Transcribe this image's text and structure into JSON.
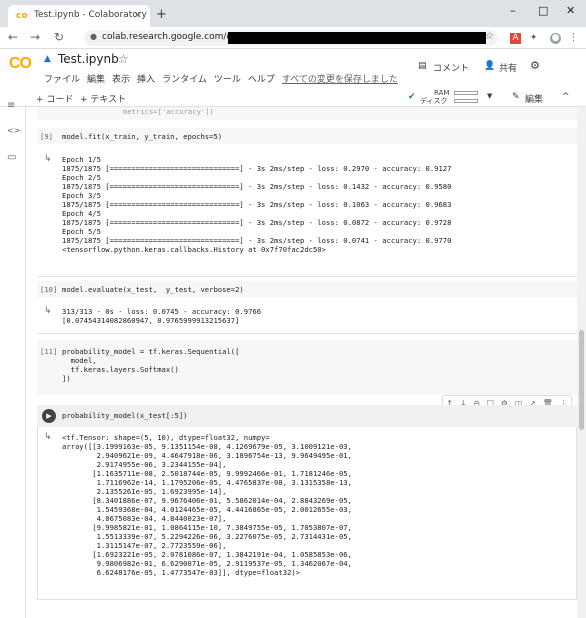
{
  "browser": {
    "tab_title": "Test.ipynb - Colaboratory",
    "new_tab": "+",
    "url": "colab.research.google.com/drive/",
    "window_controls": [
      "–",
      "□",
      "✕"
    ]
  },
  "colab": {
    "logo": "CO",
    "notebook_title": "Test.ipynb",
    "menu": [
      "ファイル",
      "編集",
      "表示",
      "挿入",
      "ランタイム",
      "ツール",
      "ヘルプ"
    ],
    "saved_status": "すべての変更を保存しました",
    "comment_label": "コメント",
    "share_label": "共有",
    "add_code": "+ コード",
    "add_text": "+ テキスト",
    "ram_label": "RAM",
    "disk_label": "ディスク",
    "edit_label": "編集"
  },
  "cells": {
    "top_partial": "metrics=['accuracy'])",
    "c9": {
      "prompt": "[9]",
      "code": "model.fit(x_train, y_train, epochs=5)",
      "output": "Epoch 1/5\n1875/1875 [==============================] - 3s 2ms/step - loss: 0.2970 - accuracy: 0.9127\nEpoch 2/5\n1875/1875 [==============================] - 3s 2ms/step - loss: 0.1432 - accuracy: 0.9580\nEpoch 3/5\n1875/1875 [==============================] - 3s 2ms/step - loss: 0.1063 - accuracy: 0.9683\nEpoch 4/5\n1875/1875 [==============================] - 3s 2ms/step - loss: 0.0872 - accuracy: 0.9728\nEpoch 5/5\n1875/1875 [==============================] - 3s 2ms/step - loss: 0.0741 - accuracy: 0.9770\n<tensorflow.python.keras.callbacks.History at 0x7f70fac2dc50>"
    },
    "c10": {
      "prompt": "[10]",
      "code": "model.evaluate(x_test,  y_test, verbose=2)",
      "output": "313/313 - 0s - loss: 0.0745 - accuracy: 0.9766\n[0.07454314082860947, 0.9765999913215637]"
    },
    "c11": {
      "prompt": "[11]",
      "code": "probability_model = tf.keras.Sequential([\n  model,\n  tf.keras.layers.Softmax()\n])"
    },
    "c12": {
      "code": "probability_model(x_test[:5])",
      "output": "<tf.Tensor: shape=(5, 10), dtype=float32, numpy=\narray([[3.1999163e-05, 9.1351154e-08, 4.1269679e-05, 3.1009121e-03,\n        2.9409621e-09, 4.4647918e-06, 3.1896754e-13, 9.9649495e-01,\n        2.9174955e-06, 3.2344155e-04],\n       [1.1635711e-08, 2.5018744e-05, 9.9992466e-01, 1.7181246e-05,\n        1.7116962e-14, 1.1795206e-05, 4.4765837e-08, 3.1315358e-13,\n        2.1355261e-05, 1.6923995e-14],\n       [8.3401886e-07, 9.9676406e-01, 5.5862014e-04, 2.8843269e-05,\n        1.5459368e-04, 4.0124465e-05, 4.4416865e-05, 2.0012655e-03,\n        4.0675083e-04, 4.8440023e-07],\n       [9.9985821e-01, 1.0864115e-10, 7.3849755e-05, 1.7053807e-07,\n        1.5513339e-07, 5.2294226e-06, 3.2276075e-05, 2.7314431e-05,\n        1.3115147e-07, 2.7723559e-06],\n       [1.6923221e-05, 2.0781086e-07, 1.3842191e-04, 1.0585853e-06,\n        9.9806982e-01, 6.6290071e-05, 2.9119537e-05, 1.3462067e-04,\n        6.6248176e-05, 1.4773547e-03]], dtype=float32)>"
    }
  },
  "icons": {
    "back": "←",
    "forward": "→",
    "reload": "↻",
    "lock": "🔒",
    "star": "☆",
    "run": "▶",
    "out_arrow": "↳",
    "cell_toolbar": [
      "↑",
      "↓",
      "⊝",
      "☐",
      "⚙",
      "◫",
      "↗",
      "🗑",
      "⋮"
    ],
    "rail": [
      "≡",
      "<>",
      "▭"
    ],
    "check": "✔",
    "pencil": "✎",
    "chevron_up": "^",
    "gear": "⚙",
    "people": "👥",
    "comment": "▤"
  }
}
